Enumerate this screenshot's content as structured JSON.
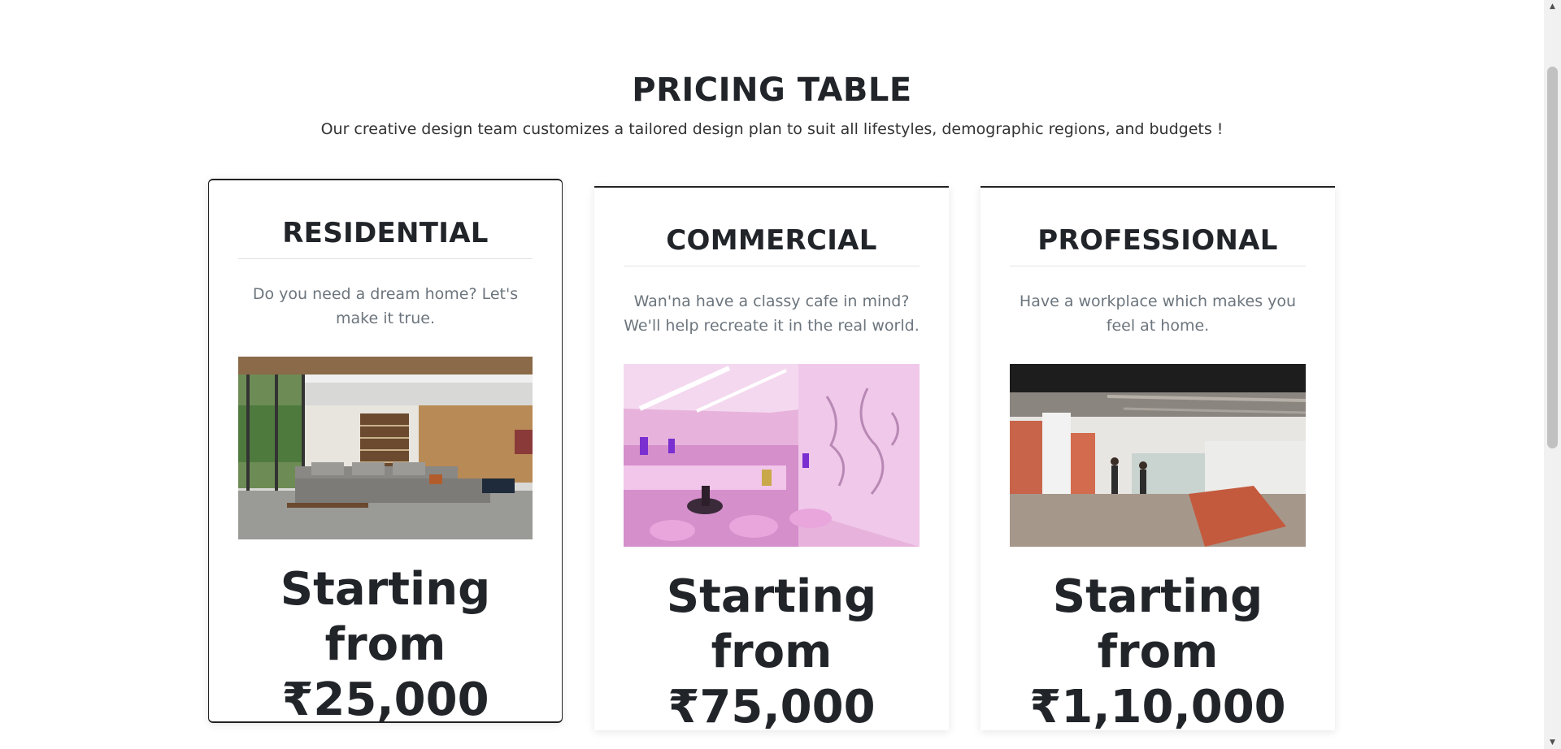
{
  "header": {
    "title": "PRICING TABLE",
    "subtitle": "Our creative design team customizes a tailored design plan to suit all lifestyles, demographic regions, and budgets !"
  },
  "cards": [
    {
      "title": "RESIDENTIAL",
      "description": "Do you need a dream home? Let's make it true.",
      "image": "modern-living-room-photo",
      "price_prefix": "Starting from",
      "price": "₹25,000"
    },
    {
      "title": "COMMERCIAL",
      "description": "Wan'na have a classy cafe in mind? We'll help recreate it in the real world.",
      "image": "pink-cafe-interior-photo",
      "price_prefix": "Starting from",
      "price": "₹75,000"
    },
    {
      "title": "PROFESSIONAL",
      "description": "Have a workplace which makes you feel at home.",
      "image": "office-workplace-photo",
      "price_prefix": "Starting from",
      "price": "₹1,10,000"
    }
  ],
  "scrollbar": {
    "up_icon": "▲",
    "down_icon": "▼"
  },
  "colors": {
    "text": "#212529",
    "muted": "#6c757d",
    "card_border": "#222222",
    "background": "#ffffff"
  }
}
